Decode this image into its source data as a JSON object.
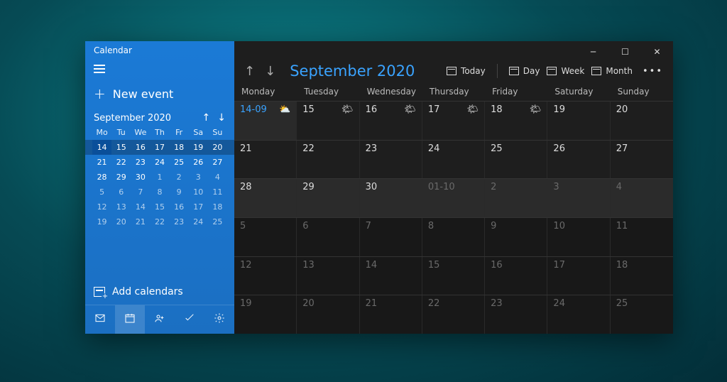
{
  "app_title": "Calendar",
  "new_event_label": "New event",
  "mini": {
    "month_label": "September 2020",
    "weekdays": [
      "Mo",
      "Tu",
      "We",
      "Th",
      "Fr",
      "Sa",
      "Su"
    ],
    "weeks": [
      [
        {
          "n": "14",
          "sel": true
        },
        {
          "n": "15"
        },
        {
          "n": "16"
        },
        {
          "n": "17"
        },
        {
          "n": "18"
        },
        {
          "n": "19"
        },
        {
          "n": "20"
        }
      ],
      [
        {
          "n": "21"
        },
        {
          "n": "22"
        },
        {
          "n": "23"
        },
        {
          "n": "24"
        },
        {
          "n": "25"
        },
        {
          "n": "26"
        },
        {
          "n": "27"
        }
      ],
      [
        {
          "n": "28"
        },
        {
          "n": "29"
        },
        {
          "n": "30"
        },
        {
          "n": "1",
          "other": true
        },
        {
          "n": "2",
          "other": true
        },
        {
          "n": "3",
          "other": true
        },
        {
          "n": "4",
          "other": true
        }
      ],
      [
        {
          "n": "5",
          "other": true
        },
        {
          "n": "6",
          "other": true
        },
        {
          "n": "7",
          "other": true
        },
        {
          "n": "8",
          "other": true
        },
        {
          "n": "9",
          "other": true
        },
        {
          "n": "10",
          "other": true
        },
        {
          "n": "11",
          "other": true
        }
      ],
      [
        {
          "n": "12",
          "other": true
        },
        {
          "n": "13",
          "other": true
        },
        {
          "n": "14",
          "other": true
        },
        {
          "n": "15",
          "other": true
        },
        {
          "n": "16",
          "other": true
        },
        {
          "n": "17",
          "other": true
        },
        {
          "n": "18",
          "other": true
        }
      ],
      [
        {
          "n": "19",
          "other": true
        },
        {
          "n": "20",
          "other": true
        },
        {
          "n": "21",
          "other": true
        },
        {
          "n": "22",
          "other": true
        },
        {
          "n": "23",
          "other": true
        },
        {
          "n": "24",
          "other": true
        },
        {
          "n": "25",
          "other": true
        }
      ]
    ]
  },
  "add_calendars_label": "Add calendars",
  "toolbar": {
    "month_label": "September 2020",
    "today": "Today",
    "day": "Day",
    "week": "Week",
    "month": "Month"
  },
  "weekdays": [
    "Monday",
    "Tuesday",
    "Wednesday",
    "Thursday",
    "Friday",
    "Saturday",
    "Sunday"
  ],
  "rows": [
    [
      {
        "n": "14-09",
        "today": true,
        "wx": "⛅"
      },
      {
        "n": "15",
        "wx": "🌤"
      },
      {
        "n": "16",
        "wx": "🌤"
      },
      {
        "n": "17",
        "wx": "🌤"
      },
      {
        "n": "18",
        "wx": "🌤"
      },
      {
        "n": "19"
      },
      {
        "n": "20"
      }
    ],
    [
      {
        "n": "21"
      },
      {
        "n": "22"
      },
      {
        "n": "23"
      },
      {
        "n": "24"
      },
      {
        "n": "25"
      },
      {
        "n": "26"
      },
      {
        "n": "27"
      }
    ],
    [
      {
        "n": "28"
      },
      {
        "n": "29"
      },
      {
        "n": "30"
      },
      {
        "n": "01-10",
        "other": true
      },
      {
        "n": "2",
        "other": true
      },
      {
        "n": "3",
        "other": true
      },
      {
        "n": "4",
        "other": true
      }
    ],
    [
      {
        "n": "5",
        "other": true
      },
      {
        "n": "6",
        "other": true
      },
      {
        "n": "7",
        "other": true
      },
      {
        "n": "8",
        "other": true
      },
      {
        "n": "9",
        "other": true
      },
      {
        "n": "10",
        "other": true
      },
      {
        "n": "11",
        "other": true
      }
    ],
    [
      {
        "n": "12",
        "other": true
      },
      {
        "n": "13",
        "other": true
      },
      {
        "n": "14",
        "other": true
      },
      {
        "n": "15",
        "other": true
      },
      {
        "n": "16",
        "other": true
      },
      {
        "n": "17",
        "other": true
      },
      {
        "n": "18",
        "other": true
      }
    ],
    [
      {
        "n": "19",
        "other": true
      },
      {
        "n": "20",
        "other": true
      },
      {
        "n": "21",
        "other": true
      },
      {
        "n": "22",
        "other": true
      },
      {
        "n": "23",
        "other": true
      },
      {
        "n": "24",
        "other": true
      },
      {
        "n": "25",
        "other": true
      }
    ]
  ]
}
